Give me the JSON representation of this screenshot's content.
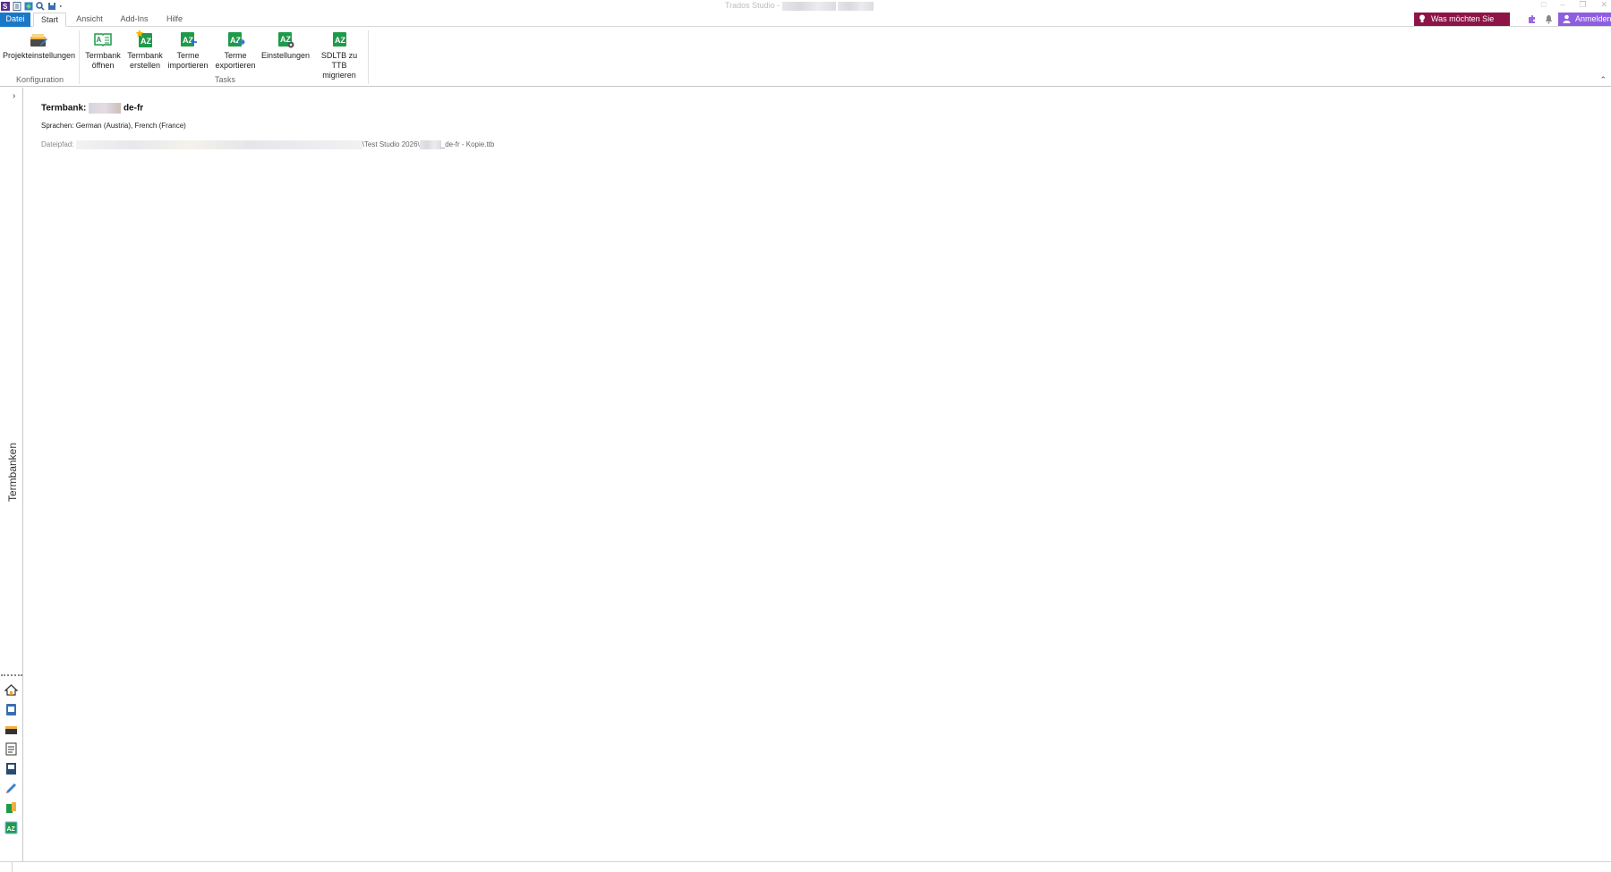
{
  "window": {
    "title": "Trados Studio",
    "controls": [
      "□",
      "–",
      "❐",
      "✕"
    ]
  },
  "ribbon_tabs": {
    "file": "Datei",
    "start": "Start",
    "view": "Ansicht",
    "addins": "Add-Ins",
    "help": "Hilfe"
  },
  "tell_me": "Was möchten Sie tun?",
  "sign_in": "Anmelden",
  "ribbon": {
    "project_settings": "Projekteinstellungen",
    "group_config": "Konfiguration",
    "open_termbase": [
      "Termbank",
      "öffnen"
    ],
    "create_termbase": [
      "Termbank",
      "erstellen"
    ],
    "import_terms": [
      "Terme",
      "importieren"
    ],
    "export_terms": [
      "Terme",
      "exportieren"
    ],
    "settings": "Einstellungen",
    "migrate": [
      "SDLTB zu TTB",
      "migrieren"
    ],
    "group_tasks": "Tasks",
    "collapse": "⌃"
  },
  "left_nav": {
    "label": "Termbanken",
    "expand": "›"
  },
  "termbase": {
    "title_prefix": "Termbank:",
    "title_suffix": "de-fr",
    "languages": "Sprachen: German (Austria), French (France)",
    "path_label": "Dateipfad:",
    "path_mid": "\\Test Studio 2026\\",
    "path_end": "_de-fr - Kopie.ttb"
  },
  "colors": {
    "file_tab": "#1a78c8",
    "tell_me": "#8c1446",
    "sign_in": "#8e5ee0",
    "green_icon": "#1e9a4a"
  }
}
